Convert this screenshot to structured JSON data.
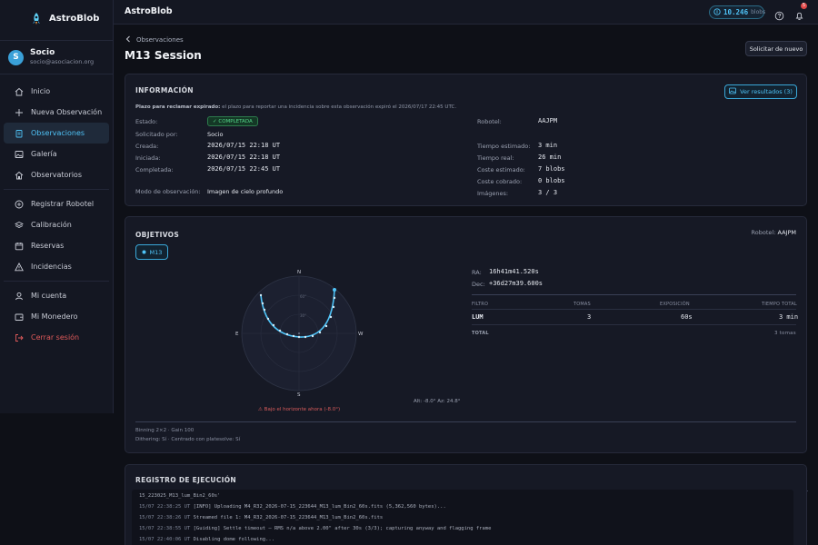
{
  "app": {
    "brand": "AstroBlob",
    "topbar_title": "AstroBlob"
  },
  "user": {
    "initial": "S",
    "name": "Socio",
    "email": "socio@asociacion.org"
  },
  "balance": {
    "value": "10.246",
    "unit": "blobs"
  },
  "notifications": {
    "count": "5"
  },
  "nav": {
    "items": [
      {
        "label": "Inicio",
        "icon": "home-icon"
      },
      {
        "label": "Nueva Observación",
        "icon": "plus-icon"
      },
      {
        "label": "Observaciones",
        "icon": "clipboard-icon",
        "active": true
      },
      {
        "label": "Galería",
        "icon": "image-icon"
      },
      {
        "label": "Observatorios",
        "icon": "observatory-icon"
      },
      {
        "label": "Registrar Robotel",
        "icon": "plus-circle-icon"
      },
      {
        "label": "Calibración",
        "icon": "layers-icon"
      },
      {
        "label": "Reservas",
        "icon": "calendar-icon"
      },
      {
        "label": "Incidencias",
        "icon": "warning-icon"
      },
      {
        "label": "Mi cuenta",
        "icon": "user-icon"
      },
      {
        "label": "Mi Monedero",
        "icon": "wallet-icon"
      },
      {
        "label": "Cerrar sesión",
        "icon": "logout-icon"
      }
    ]
  },
  "page": {
    "back_label": "Observaciones",
    "title": "M13 Session",
    "request_button": "Solicitar de nuevo"
  },
  "info": {
    "title": "INFORMACIÓN",
    "results_button": "Ver resultados (3)",
    "warning_bold": "Plazo para reclamar expirado:",
    "warning_text": " el plazo para reportar una incidencia sobre esta observación expiró el 2026/07/17 22:45 UTC.",
    "estado_label": "Estado:",
    "estado_value": "✓ COMPLETADA",
    "solicitado_label": "Solicitado por:",
    "solicitado_value": "Socio",
    "creada_label": "Creada:",
    "creada_value": "2026/07/15 22:18 UT",
    "iniciada_label": "Iniciada:",
    "iniciada_value": "2026/07/15 22:18 UT",
    "completada_label": "Completada:",
    "completada_value": "2026/07/15 22:45 UT",
    "modo_label": "Modo de observación:",
    "modo_value": "Imagen de cielo profundo",
    "robotel_label": "Robotel:",
    "robotel_value": "AAJPM",
    "t_est_label": "Tiempo estimado:",
    "t_est_value": "3 min",
    "t_real_label": "Tiempo real:",
    "t_real_value": "26 min",
    "coste_est_label": "Coste estimado:",
    "coste_est_value": "7 blobs",
    "coste_cob_label": "Coste cobrado:",
    "coste_cob_value": "0 blobs",
    "imagenes_label": "Imágenes:",
    "imagenes_value": "3 / 3"
  },
  "objetivos": {
    "title": "OBJETIVOS",
    "robotel_label": "Robotel:",
    "robotel_value": "AAJPM",
    "target": "M13",
    "ra_label": "RA:",
    "ra_value": "16h41m41.520s",
    "dec_label": "Dec:",
    "dec_value": "+36d27m39.600s",
    "table_headers": [
      "FILTRO",
      "TOMAS",
      "EXPOSICIÓN",
      "TIEMPO TOTAL"
    ],
    "row": [
      "LUM",
      "3",
      "60s",
      "3 min"
    ],
    "total_label": "TOTAL",
    "total_value": "3 tomas",
    "sky": {
      "n": "N",
      "s": "S",
      "e": "E",
      "w": "W",
      "alt_az": "Alt: -8.0° Az: 24.8°",
      "below_horizon": "⚠ Bajo el horizonte ahora (-8.0°)",
      "alt_ring_labels": [
        "60°",
        "30°"
      ],
      "accent_color": "#4fc3f7"
    },
    "binning": "Binning 2×2 · Gain 100",
    "dithering": "Dithering: Sí · Centrado con platesolve: Sí"
  },
  "log": {
    "title": "REGISTRO DE EJECUCIÓN",
    "lines": [
      {
        "ts": "",
        "msg": "15_223025_M13_lum_Bin2_60s'"
      },
      {
        "ts": "15/07 22:38:25 UT",
        "msg": " [INFO] Uploading M4_R32_2026-07-15_223644_M13_lum_Bin2_60s.fits (5,362,560 bytes)..."
      },
      {
        "ts": "15/07 22:38:26 UT",
        "msg": " Streamed file 1: M4_R32_2026-07-15_223644_M13_lum_Bin2_60s.fits"
      },
      {
        "ts": "15/07 22:38:55 UT",
        "msg": " [Guiding] Settle timeout — RMS n/a above 2.00\" after 30s (3/3); capturing anyway and flagging frame"
      },
      {
        "ts": "15/07 22:40:06 UT",
        "msg": " Disabling dome following..."
      }
    ]
  }
}
